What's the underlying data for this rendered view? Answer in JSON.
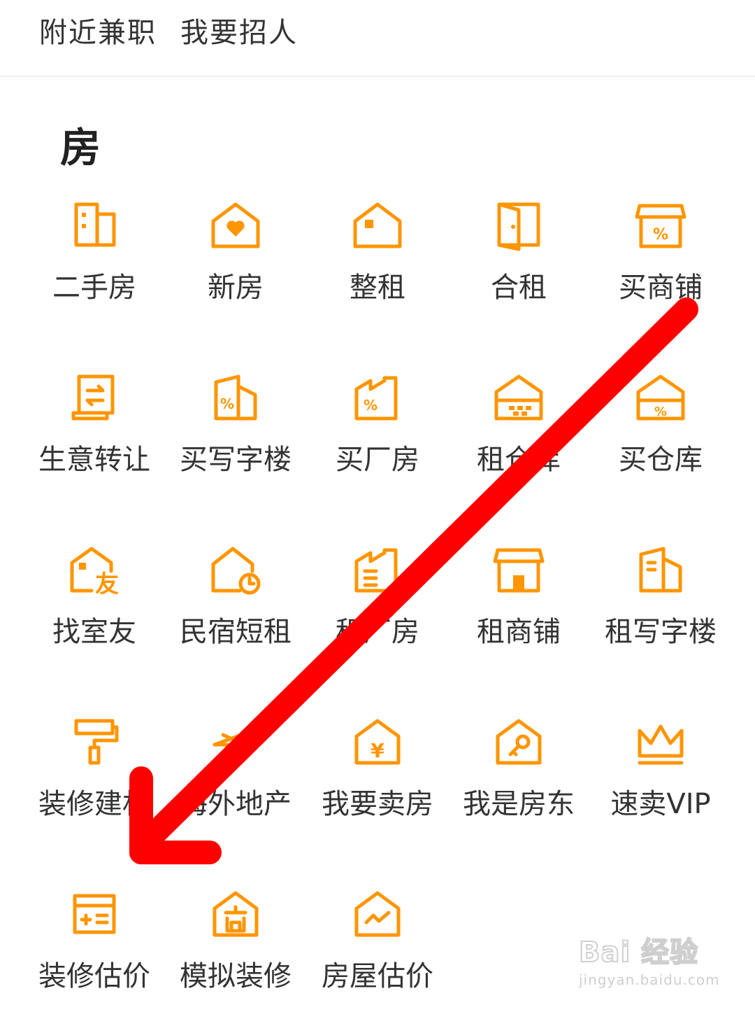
{
  "header": {
    "links": [
      "附近兼职",
      "我要招人"
    ]
  },
  "section": {
    "title": "房"
  },
  "accent_color": "#ff9500",
  "annotation_color": "#ff0000",
  "grid": [
    {
      "label": "二手房",
      "icon": "building-icon"
    },
    {
      "label": "新房",
      "icon": "house-heart-icon"
    },
    {
      "label": "整租",
      "icon": "house-icon"
    },
    {
      "label": "合租",
      "icon": "door-icon"
    },
    {
      "label": "买商铺",
      "icon": "shop-percent-icon"
    },
    {
      "label": "生意转让",
      "icon": "document-transfer-icon"
    },
    {
      "label": "买写字楼",
      "icon": "office-percent-icon"
    },
    {
      "label": "买厂房",
      "icon": "factory-percent-icon"
    },
    {
      "label": "租仓库",
      "icon": "warehouse-icon"
    },
    {
      "label": "买仓库",
      "icon": "warehouse-percent-icon"
    },
    {
      "label": "找室友",
      "icon": "house-friend-icon"
    },
    {
      "label": "民宿短租",
      "icon": "house-clock-icon"
    },
    {
      "label": "租厂房",
      "icon": "factory-icon"
    },
    {
      "label": "租商铺",
      "icon": "shop-icon"
    },
    {
      "label": "租写字楼",
      "icon": "office-icon"
    },
    {
      "label": "装修建材",
      "icon": "paint-roller-icon"
    },
    {
      "label": "海外地产",
      "icon": "plane-icon"
    },
    {
      "label": "我要卖房",
      "icon": "house-yen-icon"
    },
    {
      "label": "我是房东",
      "icon": "house-key-icon"
    },
    {
      "label": "速卖VIP",
      "icon": "crown-icon"
    },
    {
      "label": "装修估价",
      "icon": "calculator-icon"
    },
    {
      "label": "模拟装修",
      "icon": "house-building-icon"
    },
    {
      "label": "房屋估价",
      "icon": "house-chart-icon"
    }
  ],
  "watermark": {
    "brand": "Bai 经验",
    "url": "jingyan.baidu.com"
  }
}
